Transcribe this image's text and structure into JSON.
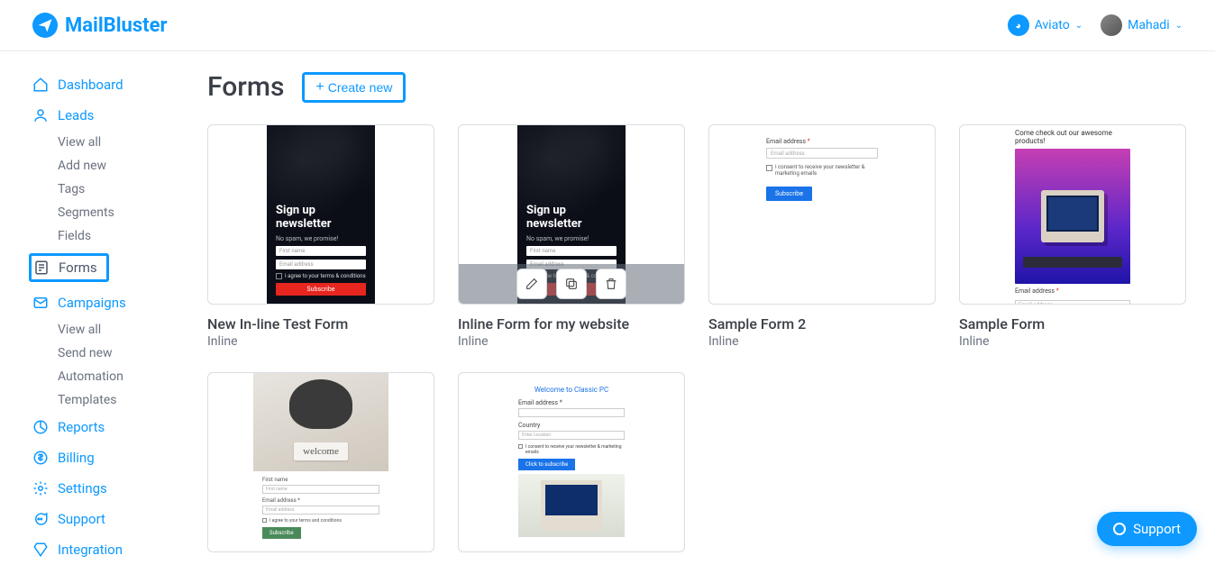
{
  "brand": {
    "name": "MailBluster"
  },
  "header": {
    "workspace": "Aviato",
    "user": "Mahadi"
  },
  "sidebar": {
    "dashboard": "Dashboard",
    "leads": {
      "label": "Leads",
      "view_all": "View all",
      "add_new": "Add new",
      "tags": "Tags",
      "segments": "Segments",
      "fields": "Fields"
    },
    "forms": "Forms",
    "campaigns": {
      "label": "Campaigns",
      "view_all": "View all",
      "send_new": "Send new",
      "automation": "Automation",
      "templates": "Templates"
    },
    "reports": "Reports",
    "billing": "Billing",
    "settings": "Settings",
    "support": "Support",
    "integration": "Integration"
  },
  "page": {
    "title": "Forms",
    "create_button": "Create new"
  },
  "forms": [
    {
      "title": "New In-line Test Form",
      "type": "Inline"
    },
    {
      "title": "Inline Form for my website",
      "type": "Inline"
    },
    {
      "title": "Sample Form 2",
      "type": "Inline"
    },
    {
      "title": "Sample Form",
      "type": "Inline"
    }
  ],
  "thumb_text": {
    "signup_heading": "Sign up newsletter",
    "no_spam": "No spam, we promise!",
    "first_name": "First name",
    "email": "Email address",
    "email_label": "Email address",
    "email_label_req": "Email address *",
    "agree_terms": "I agree to your terms & conditions",
    "consent_news": "I consent to receive your newsletter & marketing emails",
    "subscribe": "Subscribe",
    "retro_tag": "Come check out our awesome products!",
    "welcome_sign": "welcome",
    "welcome_first": "First name",
    "welcome_email_lbl": "Email address *",
    "welcome_chk": "I agree to your terms and conditions",
    "classic_title": "Welcome to Classic PC",
    "country": "Country",
    "enter_location": "Enter Location",
    "click_subscribe": "Click to subscribe"
  },
  "support_widget": "Support"
}
